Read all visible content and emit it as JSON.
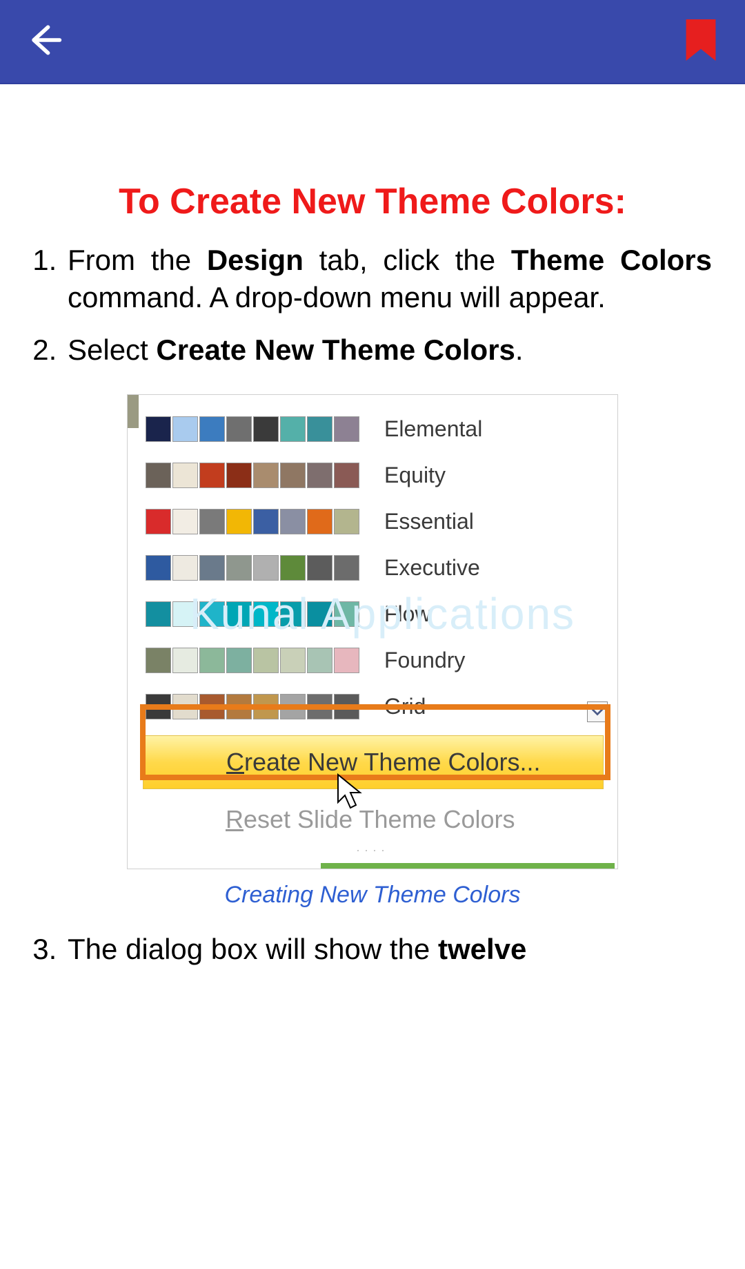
{
  "appbar": {
    "back_icon": "back-arrow-icon",
    "bookmark_icon": "bookmark-icon"
  },
  "content": {
    "heading": "To Create New Theme Colors:",
    "steps": {
      "s1_a": "From the ",
      "s1_b": "Design",
      "s1_c": " tab, click the ",
      "s1_d": "Theme Colors",
      "s1_e": " command. A drop-down menu will appear.",
      "s2_a": "Select ",
      "s2_b": "Create New Theme Colors",
      "s2_c": ".",
      "s3_a": "The dialog box will show the ",
      "s3_b": "twelve"
    },
    "caption": "Creating New Theme Colors"
  },
  "dropdown": {
    "watermark": "Kunal Applications",
    "themes": [
      {
        "name": "Elemental",
        "colors": [
          "#1a244c",
          "#a9cbee",
          "#3c7cbf",
          "#6f6f6f",
          "#3a3a3a",
          "#54b0a9",
          "#39909a",
          "#8d8193"
        ]
      },
      {
        "name": "Equity",
        "colors": [
          "#6b6259",
          "#ece5d6",
          "#c23d1e",
          "#8b2e17",
          "#a98c6e",
          "#8f7763",
          "#7e6e6e",
          "#8a5a55"
        ]
      },
      {
        "name": "Essential",
        "colors": [
          "#d92b2b",
          "#f2ede4",
          "#7a7a7a",
          "#f2b705",
          "#3b5fa3",
          "#8a8fa3",
          "#e06a1a",
          "#b3b58e"
        ]
      },
      {
        "name": "Executive",
        "colors": [
          "#2e5aa0",
          "#eeeae1",
          "#6a7a8b",
          "#8f978e",
          "#b0b0b0",
          "#5e8a3a",
          "#5c5c5c",
          "#6c6c6c"
        ]
      },
      {
        "name": "Flow",
        "colors": [
          "#138fa0",
          "#d6f3f6",
          "#1fb4c9",
          "#00a6b5",
          "#00b7c8",
          "#089dab",
          "#0a8fa0",
          "#6fb7a5"
        ]
      },
      {
        "name": "Foundry",
        "colors": [
          "#7a8266",
          "#e6ebe1",
          "#8cb89a",
          "#7db0a0",
          "#b9c4a3",
          "#c9d0b8",
          "#a8c4b4",
          "#e7b7be"
        ]
      },
      {
        "name": "Grid",
        "colors": [
          "#3a3a3a",
          "#e2dccd",
          "#a85a2e",
          "#b37a3e",
          "#c0974e",
          "#a4a4a4",
          "#6d6d6d",
          "#5a5a5a"
        ]
      }
    ],
    "create_label_pre": "C",
    "create_label_rest": "reate New Theme Colors...",
    "reset_pre": "R",
    "reset_rest": "eset Slide Theme Colors"
  }
}
